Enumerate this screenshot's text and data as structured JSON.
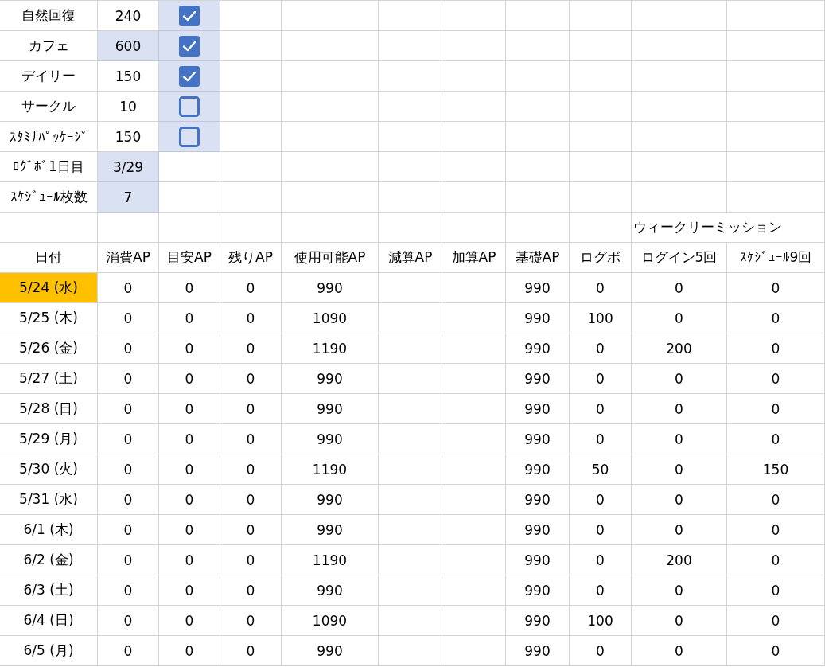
{
  "settings": [
    {
      "label": "自然回復",
      "value": "240",
      "highlighted": false,
      "kind": "toggle",
      "checked": true
    },
    {
      "label": "カフェ",
      "value": "600",
      "highlighted": true,
      "kind": "toggle",
      "checked": true
    },
    {
      "label": "デイリー",
      "value": "150",
      "highlighted": false,
      "kind": "toggle",
      "checked": true
    },
    {
      "label": "サークル",
      "value": "10",
      "highlighted": false,
      "kind": "toggle",
      "checked": false
    },
    {
      "label": "ｽﾀﾐﾅﾊﾟｯｹｰｼﾞ",
      "value": "150",
      "highlighted": false,
      "kind": "toggle",
      "checked": false
    },
    {
      "label": "ﾛｸﾞﾎﾞ1日目",
      "value": "3/29",
      "highlighted": true,
      "kind": "value"
    },
    {
      "label": "ｽｹｼﾞｭｰﾙ枚数",
      "value": "7",
      "highlighted": true,
      "kind": "value"
    }
  ],
  "section_label": "ウィークリーミッション",
  "columns": [
    "日付",
    "消費AP",
    "目安AP",
    "残りAP",
    "使用可能AP",
    "減算AP",
    "加算AP",
    "基礎AP",
    "ログボ",
    "ログイン5回",
    "ｽｹｼﾞｭｰﾙ9回"
  ],
  "rows": [
    {
      "date": "5/24 (水)",
      "selected": true,
      "cells": [
        "0",
        "0",
        "0",
        "990",
        null,
        null,
        "990",
        "0",
        "0",
        "0"
      ]
    },
    {
      "date": "5/25 (木)",
      "selected": false,
      "cells": [
        "0",
        "0",
        "0",
        "1090",
        null,
        null,
        "990",
        "100",
        "0",
        "0"
      ]
    },
    {
      "date": "5/26 (金)",
      "selected": false,
      "cells": [
        "0",
        "0",
        "0",
        "1190",
        null,
        null,
        "990",
        "0",
        "200",
        "0"
      ]
    },
    {
      "date": "5/27 (土)",
      "selected": false,
      "cells": [
        "0",
        "0",
        "0",
        "990",
        null,
        null,
        "990",
        "0",
        "0",
        "0"
      ]
    },
    {
      "date": "5/28 (日)",
      "selected": false,
      "cells": [
        "0",
        "0",
        "0",
        "990",
        null,
        null,
        "990",
        "0",
        "0",
        "0"
      ]
    },
    {
      "date": "5/29 (月)",
      "selected": false,
      "cells": [
        "0",
        "0",
        "0",
        "990",
        null,
        null,
        "990",
        "0",
        "0",
        "0"
      ]
    },
    {
      "date": "5/30 (火)",
      "selected": false,
      "cells": [
        "0",
        "0",
        "0",
        "1190",
        null,
        null,
        "990",
        "50",
        "0",
        "150"
      ]
    },
    {
      "date": "5/31 (水)",
      "selected": false,
      "cells": [
        "0",
        "0",
        "0",
        "990",
        null,
        null,
        "990",
        "0",
        "0",
        "0"
      ]
    },
    {
      "date": "6/1 (木)",
      "selected": false,
      "cells": [
        "0",
        "0",
        "0",
        "990",
        null,
        null,
        "990",
        "0",
        "0",
        "0"
      ]
    },
    {
      "date": "6/2 (金)",
      "selected": false,
      "cells": [
        "0",
        "0",
        "0",
        "1190",
        null,
        null,
        "990",
        "0",
        "200",
        "0"
      ]
    },
    {
      "date": "6/3 (土)",
      "selected": false,
      "cells": [
        "0",
        "0",
        "0",
        "990",
        null,
        null,
        "990",
        "0",
        "0",
        "0"
      ]
    },
    {
      "date": "6/4 (日)",
      "selected": false,
      "cells": [
        "0",
        "0",
        "0",
        "1090",
        null,
        null,
        "990",
        "100",
        "0",
        "0"
      ]
    },
    {
      "date": "6/5 (月)",
      "selected": false,
      "cells": [
        "0",
        "0",
        "0",
        "990",
        null,
        null,
        "990",
        "0",
        "0",
        "0"
      ]
    }
  ]
}
